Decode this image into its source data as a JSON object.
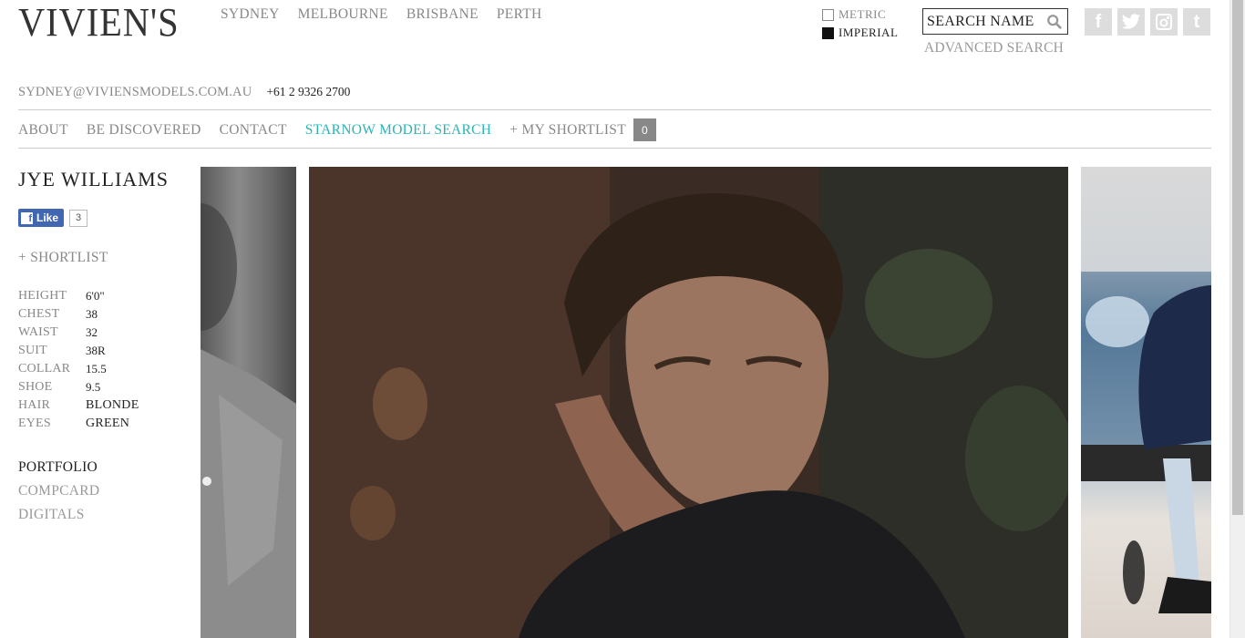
{
  "logo": "VIVIEN'S",
  "cities": [
    "SYDNEY",
    "MELBOURNE",
    "BRISBANE",
    "PERTH"
  ],
  "units": {
    "metric": "METRIC",
    "imperial": "IMPERIAL",
    "selected": "imperial"
  },
  "search": {
    "placeholder": "SEARCH NAME",
    "advanced": "ADVANCED SEARCH"
  },
  "social": [
    "facebook-icon",
    "twitter-icon",
    "instagram-icon",
    "tumblr-icon"
  ],
  "contact": {
    "email": "SYDNEY@VIVIENSMODELS.COM.AU",
    "phone": "+61 2 9326 2700"
  },
  "nav": {
    "about": "ABOUT",
    "be_discovered": "BE DISCOVERED",
    "contact": "CONTACT",
    "starnow": "STARNOW MODEL SEARCH",
    "my_shortlist": "+ MY SHORTLIST",
    "shortlist_count": "0"
  },
  "model": {
    "name": "JYE WILLIAMS",
    "fb_like": "Like",
    "fb_count": "3",
    "add_shortlist": "+ SHORTLIST",
    "stats": [
      {
        "label": "HEIGHT",
        "value": "6'0\""
      },
      {
        "label": "CHEST",
        "value": "38"
      },
      {
        "label": "WAIST",
        "value": "32"
      },
      {
        "label": "SUIT",
        "value": "38R"
      },
      {
        "label": "COLLAR",
        "value": "15.5"
      },
      {
        "label": "SHOE",
        "value": "9.5"
      },
      {
        "label": "HAIR",
        "value": "BLONDE"
      },
      {
        "label": "EYES",
        "value": "GREEN"
      }
    ],
    "links": {
      "portfolio": "PORTFOLIO",
      "compcard": "COMPCARD",
      "digitals": "DIGITALS"
    }
  },
  "colors": {
    "accent": "#2ab5b5",
    "muted": "#888888",
    "text": "#222222",
    "fb": "#4267b2"
  }
}
